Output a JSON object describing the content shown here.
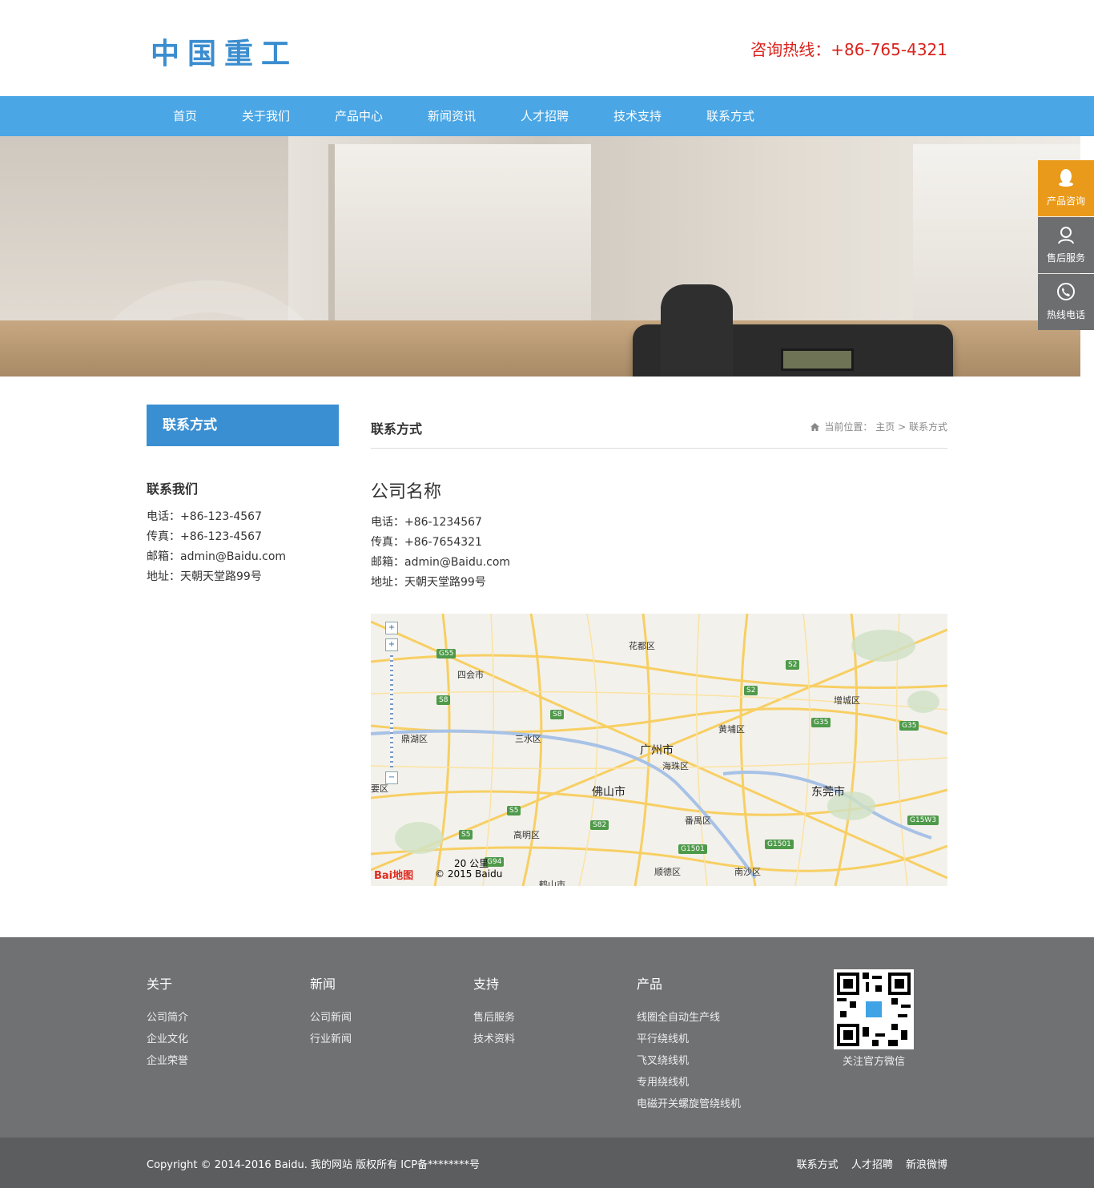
{
  "header": {
    "logo_text": "中国重工",
    "hotline": "咨询热线：+86-765-4321"
  },
  "nav": {
    "items": [
      "首页",
      "关于我们",
      "产品中心",
      "新闻资讯",
      "人才招聘",
      "技术支持",
      "联系方式"
    ]
  },
  "float_menu": [
    {
      "label": "产品咨询",
      "icon": "qq-icon"
    },
    {
      "label": "售后服务",
      "icon": "service-icon"
    },
    {
      "label": "热线电话",
      "icon": "phone-icon"
    }
  ],
  "side": {
    "title": "联系方式",
    "subtitle": "联系我们",
    "lines": [
      "电话：+86-123-4567",
      "传真：+86-123-4567",
      "邮箱：admin@Baidu.com",
      "地址：天朝天堂路99号"
    ]
  },
  "main": {
    "title": "联系方式",
    "breadcrumb_prefix": "当前位置：",
    "breadcrumb_home": "主页",
    "breadcrumb_sep": ">",
    "breadcrumb_current": "联系方式",
    "company": "公司名称",
    "lines": [
      "电话：+86-1234567",
      "传真：+86-7654321",
      "邮箱：admin@Baidu.com",
      "地址：天朝天堂路99号"
    ]
  },
  "map": {
    "labels": {
      "huadu": "花都区",
      "sihui": "四会市",
      "dinghu": "鼎湖区",
      "sanshui": "三水区",
      "guangzhou": "广州市",
      "haizhu": "海珠区",
      "huangpu": "黄埔区",
      "zengcheng": "增城区",
      "foshan": "佛山市",
      "dongguan": "东莞市",
      "gaoming": "高明区",
      "panyu": "番禺区",
      "shunde": "顺德区",
      "nansha": "南沙区",
      "yaoqu": "要区",
      "heshan": "鹤山市"
    },
    "shields": {
      "g55": "G55",
      "s8a": "S8",
      "s8b": "S8",
      "s2a": "S2",
      "s2b": "S2",
      "g35a": "G35",
      "g35b": "G35",
      "s5a": "S5",
      "s5b": "S5",
      "s82": "S82",
      "g1501a": "G1501",
      "g1501b": "G1501",
      "g15w3": "G15W3",
      "g94": "G94"
    },
    "scale": "20 公里",
    "copyright": "© 2015 Baidu",
    "logo": "Bai地图"
  },
  "footer": {
    "cols": [
      {
        "title": "关于",
        "items": [
          "公司简介",
          "企业文化",
          "企业荣誉"
        ]
      },
      {
        "title": "新闻",
        "items": [
          "公司新闻",
          "行业新闻"
        ]
      },
      {
        "title": "支持",
        "items": [
          "售后服务",
          "技术资料"
        ]
      },
      {
        "title": "产品",
        "items": [
          "线圈全自动生产线",
          "平行绕线机",
          "飞叉绕线机",
          "专用绕线机",
          "电磁开关螺旋管绕线机"
        ]
      }
    ],
    "qr_label": "关注官方微信",
    "copyright": "Copyright © 2014-2016 Baidu. 我的网站 版权所有  ICP备********号",
    "links": [
      "联系方式",
      "人才招聘",
      "新浪微博"
    ]
  },
  "colors": {
    "nav": "#4aa6e4",
    "side_title": "#3a8fd2",
    "hotline": "#d9231c",
    "float_active": "#ea9a1a",
    "footer": "#707173"
  }
}
